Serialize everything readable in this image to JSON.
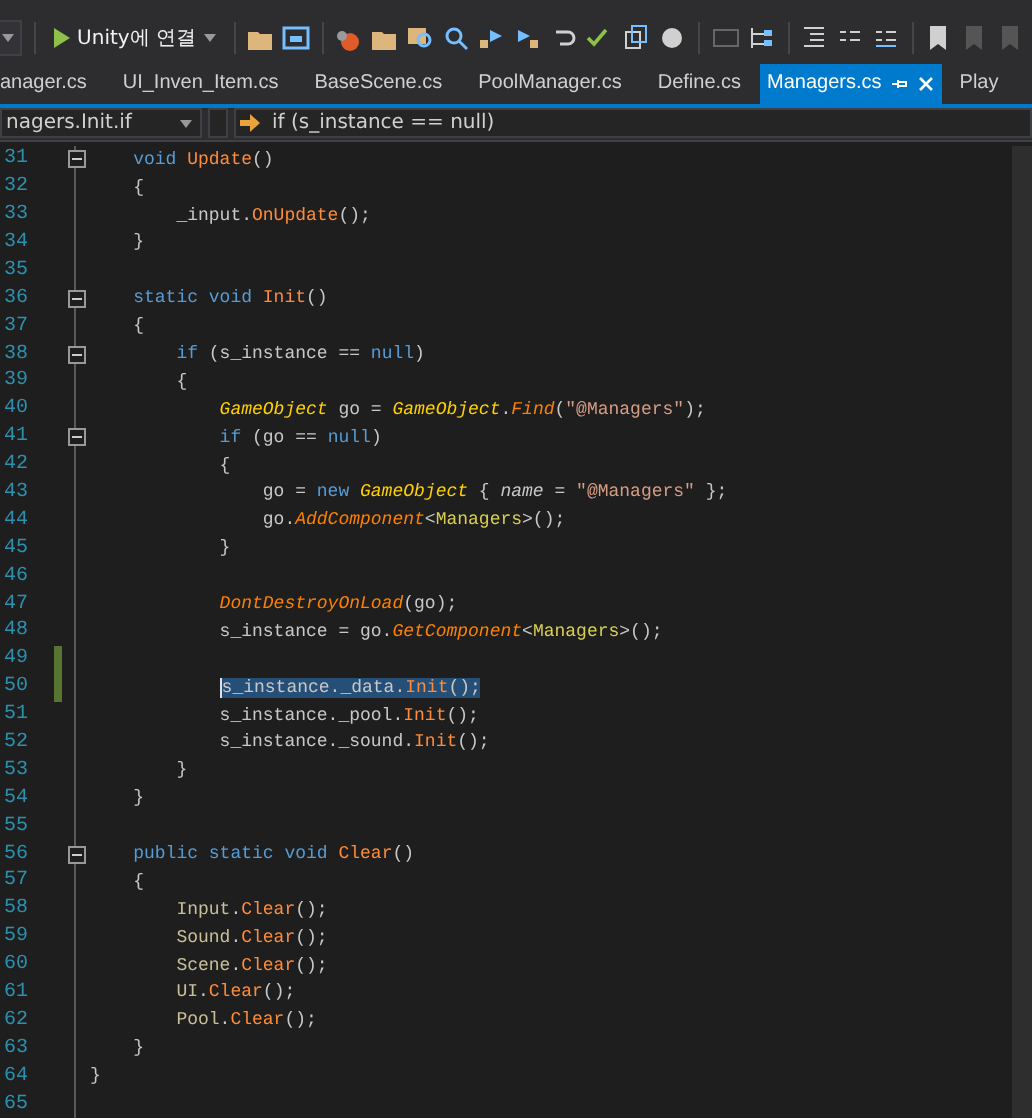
{
  "toolbar": {
    "run_button": "Unity에 연결"
  },
  "tabs": [
    {
      "label": "anager.cs",
      "selected": false
    },
    {
      "label": "UI_Inven_Item.cs",
      "selected": false
    },
    {
      "label": "BaseScene.cs",
      "selected": false
    },
    {
      "label": "PoolManager.cs",
      "selected": false
    },
    {
      "label": "Define.cs",
      "selected": false
    },
    {
      "label": "Managers.cs",
      "selected": true
    },
    {
      "label": "Play",
      "selected": false
    }
  ],
  "navigation": {
    "member": "nagers.Init.if",
    "scope": "if (s_instance == null)"
  },
  "lines": [
    {
      "number": "31",
      "kind": "class",
      "tokens": [
        {
          "kind": "kw",
          "text": "void "
        },
        {
          "kind": "method",
          "text": "Update"
        },
        {
          "kind": "plain",
          "text": "()"
        }
      ],
      "foldable": true,
      "changed": false,
      "selected": false
    },
    {
      "number": "32",
      "kind": "class",
      "tokens": [
        {
          "kind": "plain",
          "text": "{"
        }
      ],
      "foldable": false,
      "changed": false,
      "selected": false
    },
    {
      "number": "33",
      "kind": "method",
      "tokens": [
        {
          "kind": "plain",
          "text": "_input."
        },
        {
          "kind": "method",
          "text": "OnUpdate"
        },
        {
          "kind": "plain",
          "text": "();"
        }
      ],
      "foldable": false,
      "changed": false,
      "selected": false
    },
    {
      "number": "34",
      "kind": "class",
      "tokens": [
        {
          "kind": "plain",
          "text": "}"
        }
      ],
      "foldable": false,
      "changed": false,
      "selected": false
    },
    {
      "number": "35",
      "foldable": false,
      "changed": false,
      "selected": false
    },
    {
      "number": "36",
      "kind": "class",
      "tokens": [
        {
          "kind": "kw",
          "text": "static void "
        },
        {
          "kind": "method",
          "text": "Init"
        },
        {
          "kind": "plain",
          "text": "()"
        }
      ],
      "foldable": true,
      "changed": false,
      "selected": false
    },
    {
      "number": "37",
      "kind": "class",
      "tokens": [
        {
          "kind": "plain",
          "text": "{"
        }
      ],
      "foldable": false,
      "changed": false,
      "selected": false
    },
    {
      "number": "38",
      "kind": "method",
      "tokens": [
        {
          "kind": "kw",
          "text": "if"
        },
        {
          "kind": "plain",
          "text": " (s_instance == "
        },
        {
          "kind": "kw",
          "text": "null"
        },
        {
          "kind": "plain",
          "text": ")"
        }
      ],
      "foldable": true,
      "changed": false,
      "selected": false
    },
    {
      "number": "39",
      "kind": "method",
      "tokens": [
        {
          "kind": "plain",
          "text": "{"
        }
      ],
      "foldable": false,
      "changed": false,
      "selected": false
    },
    {
      "number": "40",
      "kind": "block",
      "tokens": [
        {
          "kind": "type",
          "text": "GameObject"
        },
        {
          "kind": "plain",
          "text": " go = "
        },
        {
          "kind": "type",
          "text": "GameObject"
        },
        {
          "kind": "plain",
          "text": "."
        },
        {
          "kind": "smethod",
          "text": "Find"
        },
        {
          "kind": "plain",
          "text": "("
        },
        {
          "kind": "str",
          "text": "\"@Managers\""
        },
        {
          "kind": "plain",
          "text": ");"
        }
      ],
      "foldable": false,
      "changed": false,
      "selected": false
    },
    {
      "number": "41",
      "kind": "block",
      "tokens": [
        {
          "kind": "kw",
          "text": "if"
        },
        {
          "kind": "plain",
          "text": " (go == "
        },
        {
          "kind": "kw",
          "text": "null"
        },
        {
          "kind": "plain",
          "text": ")"
        }
      ],
      "foldable": true,
      "changed": false,
      "selected": false
    },
    {
      "number": "42",
      "kind": "block",
      "tokens": [
        {
          "kind": "plain",
          "text": "{"
        }
      ],
      "foldable": false,
      "changed": false,
      "selected": false
    },
    {
      "number": "43",
      "kind": "inner",
      "tokens": [
        {
          "kind": "plain",
          "text": "go = "
        },
        {
          "kind": "kw",
          "text": "new"
        },
        {
          "kind": "type",
          "text": " GameObject"
        },
        {
          "kind": "plain",
          "text": " { "
        },
        {
          "kind": "prop",
          "text": "name"
        },
        {
          "kind": "plain",
          "text": " = "
        },
        {
          "kind": "str",
          "text": "\"@Managers\""
        },
        {
          "kind": "plain",
          "text": " };"
        }
      ],
      "foldable": false,
      "changed": false,
      "selected": false
    },
    {
      "number": "44",
      "kind": "inner",
      "tokens": [
        {
          "kind": "plain",
          "text": "go."
        },
        {
          "kind": "smethod",
          "text": "AddComponent"
        },
        {
          "kind": "plain",
          "text": "<"
        },
        {
          "kind": "cls",
          "text": "Managers"
        },
        {
          "kind": "plain",
          "text": ">();"
        }
      ],
      "foldable": false,
      "changed": false,
      "selected": false
    },
    {
      "number": "45",
      "kind": "block",
      "tokens": [
        {
          "kind": "plain",
          "text": "}"
        }
      ],
      "foldable": false,
      "changed": false,
      "selected": false
    },
    {
      "number": "46",
      "foldable": false,
      "changed": false,
      "selected": false
    },
    {
      "number": "47",
      "kind": "block",
      "tokens": [
        {
          "kind": "smethod",
          "text": "DontDestroyOnLoad"
        },
        {
          "kind": "plain",
          "text": "(go);"
        }
      ],
      "foldable": false,
      "changed": false,
      "selected": false
    },
    {
      "number": "48",
      "kind": "block",
      "tokens": [
        {
          "kind": "plain",
          "text": "s_instance = go."
        },
        {
          "kind": "smethod",
          "text": "GetComponent"
        },
        {
          "kind": "plain",
          "text": "<"
        },
        {
          "kind": "cls",
          "text": "Managers"
        },
        {
          "kind": "plain",
          "text": ">();"
        }
      ],
      "foldable": false,
      "changed": false,
      "selected": false
    },
    {
      "number": "49",
      "foldable": false,
      "changed": true,
      "selected": false
    },
    {
      "number": "50",
      "kind": "block",
      "tokens": [
        {
          "kind": "plain",
          "text": "s_instance._data."
        },
        {
          "kind": "method",
          "text": "Init"
        },
        {
          "kind": "plain",
          "text": "();"
        }
      ],
      "foldable": false,
      "changed": true,
      "selected": true
    },
    {
      "number": "51",
      "kind": "block",
      "tokens": [
        {
          "kind": "plain",
          "text": "s_instance._pool."
        },
        {
          "kind": "method",
          "text": "Init"
        },
        {
          "kind": "plain",
          "text": "();"
        }
      ],
      "foldable": false,
      "changed": false,
      "selected": false
    },
    {
      "number": "52",
      "kind": "block",
      "tokens": [
        {
          "kind": "plain",
          "text": "s_instance._sound."
        },
        {
          "kind": "method",
          "text": "Init"
        },
        {
          "kind": "plain",
          "text": "();"
        }
      ],
      "foldable": false,
      "changed": false,
      "selected": false
    },
    {
      "number": "53",
      "kind": "method",
      "tokens": [
        {
          "kind": "plain",
          "text": "}"
        }
      ],
      "foldable": false,
      "changed": false,
      "selected": false
    },
    {
      "number": "54",
      "kind": "class",
      "tokens": [
        {
          "kind": "plain",
          "text": "}"
        }
      ],
      "foldable": false,
      "changed": false,
      "selected": false
    },
    {
      "number": "55",
      "foldable": false,
      "changed": false,
      "selected": false
    },
    {
      "number": "56",
      "kind": "class",
      "tokens": [
        {
          "kind": "kw",
          "text": "public static void "
        },
        {
          "kind": "method",
          "text": "Clear"
        },
        {
          "kind": "plain",
          "text": "()"
        }
      ],
      "foldable": true,
      "changed": false,
      "selected": false
    },
    {
      "number": "57",
      "kind": "class",
      "tokens": [
        {
          "kind": "plain",
          "text": "{"
        }
      ],
      "foldable": false,
      "changed": false,
      "selected": false
    },
    {
      "number": "58",
      "kind": "method",
      "tokens": [
        {
          "kind": "ref",
          "text": "Input"
        },
        {
          "kind": "plain",
          "text": "."
        },
        {
          "kind": "method",
          "text": "Clear"
        },
        {
          "kind": "plain",
          "text": "();"
        }
      ],
      "foldable": false,
      "changed": false,
      "selected": false
    },
    {
      "number": "59",
      "kind": "method",
      "tokens": [
        {
          "kind": "ref",
          "text": "Sound"
        },
        {
          "kind": "plain",
          "text": "."
        },
        {
          "kind": "method",
          "text": "Clear"
        },
        {
          "kind": "plain",
          "text": "();"
        }
      ],
      "foldable": false,
      "changed": false,
      "selected": false
    },
    {
      "number": "60",
      "kind": "method",
      "tokens": [
        {
          "kind": "ref",
          "text": "Scene"
        },
        {
          "kind": "plain",
          "text": "."
        },
        {
          "kind": "method",
          "text": "Clear"
        },
        {
          "kind": "plain",
          "text": "();"
        }
      ],
      "foldable": false,
      "changed": false,
      "selected": false
    },
    {
      "number": "61",
      "kind": "method",
      "tokens": [
        {
          "kind": "ref",
          "text": "UI"
        },
        {
          "kind": "plain",
          "text": "."
        },
        {
          "kind": "method",
          "text": "Clear"
        },
        {
          "kind": "plain",
          "text": "();"
        }
      ],
      "foldable": false,
      "changed": false,
      "selected": false
    },
    {
      "number": "62",
      "kind": "method",
      "tokens": [
        {
          "kind": "ref",
          "text": "Pool"
        },
        {
          "kind": "plain",
          "text": "."
        },
        {
          "kind": "method",
          "text": "Clear"
        },
        {
          "kind": "plain",
          "text": "();"
        }
      ],
      "foldable": false,
      "changed": false,
      "selected": false
    },
    {
      "number": "63",
      "kind": "class",
      "tokens": [
        {
          "kind": "plain",
          "text": "}"
        }
      ],
      "foldable": false,
      "changed": false,
      "selected": false
    },
    {
      "number": "64",
      "kind": "namespace",
      "tokens": [
        {
          "kind": "plain",
          "text": "}"
        }
      ],
      "foldable": false,
      "changed": false,
      "selected": false
    },
    {
      "number": "65",
      "foldable": false,
      "changed": false,
      "selected": false
    }
  ]
}
